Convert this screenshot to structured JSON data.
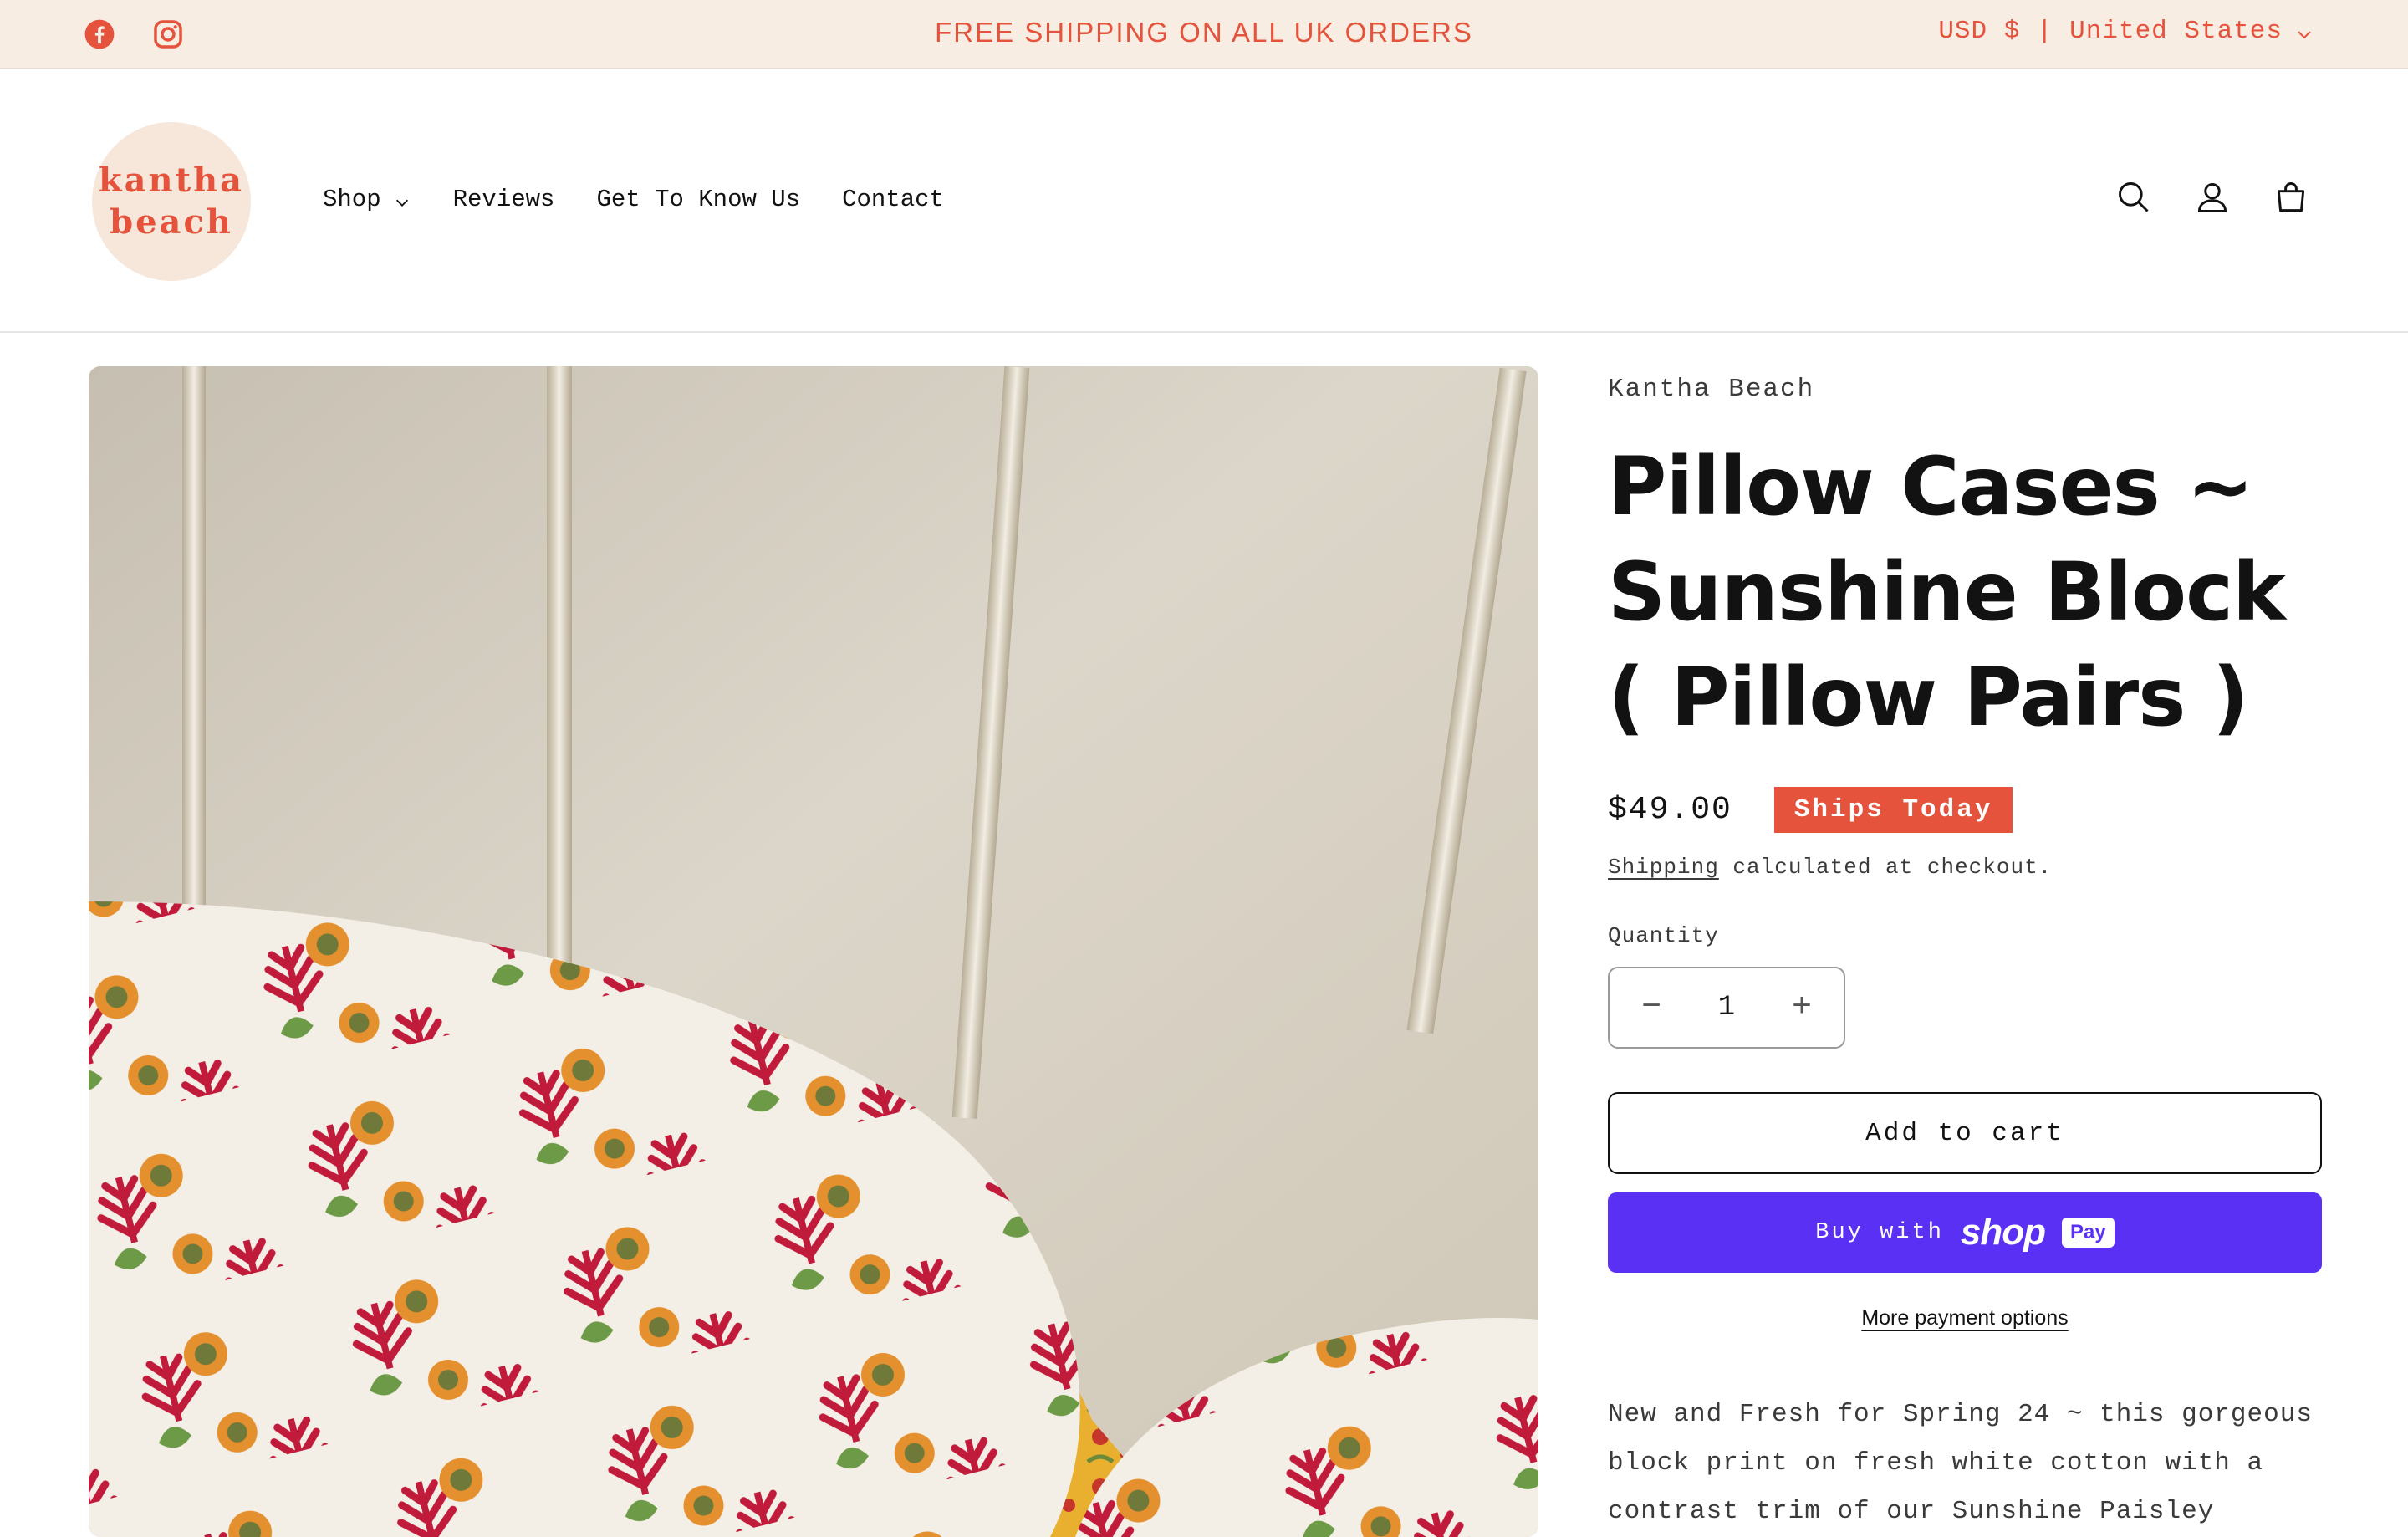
{
  "announcement": {
    "text": "FREE SHIPPING ON ALL UK ORDERS",
    "currency": "USD $ | United States",
    "social": [
      "facebook-icon",
      "instagram-icon"
    ]
  },
  "header": {
    "logo_line1": "kantha",
    "logo_line2": "beach",
    "nav": [
      {
        "label": "Shop",
        "has_dropdown": true
      },
      {
        "label": "Reviews"
      },
      {
        "label": "Get To Know Us"
      },
      {
        "label": "Contact"
      }
    ],
    "icons": [
      "search-icon",
      "account-icon",
      "cart-icon"
    ]
  },
  "product": {
    "vendor": "Kantha Beach",
    "title": "Pillow Cases ~ Sunshine Block ( Pillow Pairs )",
    "price": "$49.00",
    "badge": "Ships Today",
    "shipping_link": "Shipping",
    "shipping_rest": " calculated at checkout.",
    "quantity_label": "Quantity",
    "quantity_value": "1",
    "minus": "−",
    "plus": "+",
    "add_to_cart": "Add to cart",
    "buy_with": "Buy with",
    "shop_word": "shop",
    "pay_word": "Pay",
    "more_payment": "More payment options",
    "description": "New and Fresh for Spring 24 ~ this gorgeous block print on fresh white cotton with a contrast trim of our Sunshine Paisley"
  },
  "colors": {
    "accent": "#e5533c",
    "announcement_bg": "#f7ede3",
    "shop_pay": "#5a31f4"
  }
}
